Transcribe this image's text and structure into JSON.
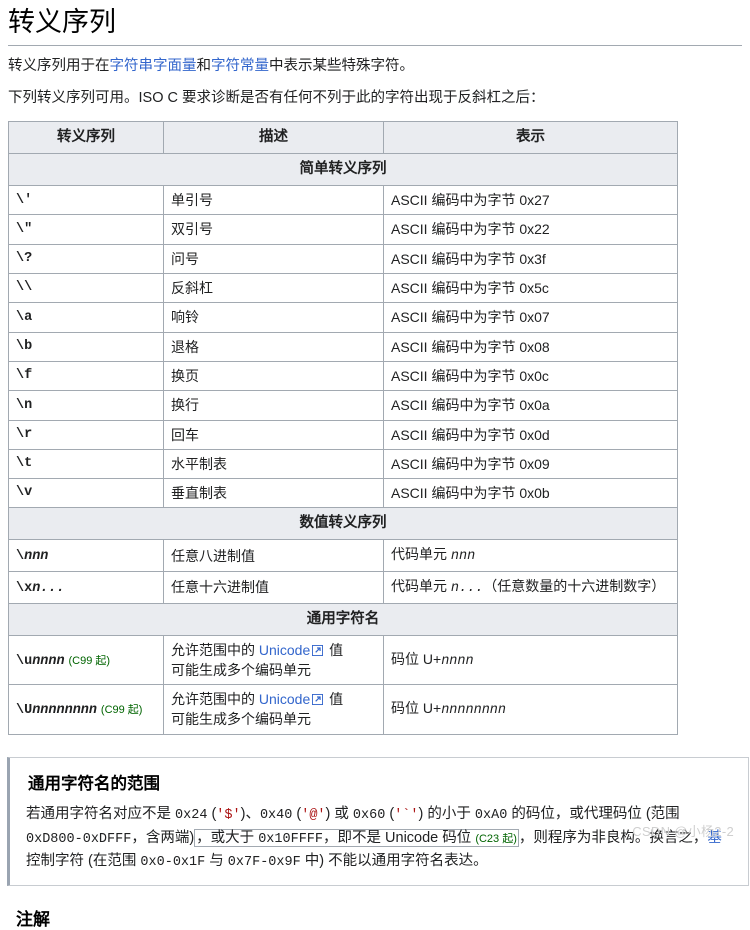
{
  "page": {
    "title": "转义序列",
    "intro_1_prefix": "转义序列用于在",
    "intro_1_link1": "字符串字面量",
    "intro_1_mid": "和",
    "intro_1_link2": "字符常量",
    "intro_1_suffix": "中表示某些特殊字符。",
    "intro_2": "下列转义序列可用。ISO C 要求诊断是否有任何不列于此的字符出现于反斜杠之后："
  },
  "table": {
    "headers": [
      "转义序列",
      "描述",
      "表示"
    ],
    "sections": [
      {
        "title": "简单转义序列",
        "rows": [
          {
            "seq": "\\'",
            "desc": "单引号",
            "repr": "ASCII 编码中为字节 0x27"
          },
          {
            "seq": "\\\"",
            "desc": "双引号",
            "repr": "ASCII 编码中为字节 0x22"
          },
          {
            "seq": "\\?",
            "desc": "问号",
            "repr": "ASCII 编码中为字节 0x3f"
          },
          {
            "seq": "\\\\",
            "desc": "反斜杠",
            "repr": "ASCII 编码中为字节 0x5c"
          },
          {
            "seq": "\\a",
            "desc": "响铃",
            "repr": "ASCII 编码中为字节 0x07"
          },
          {
            "seq": "\\b",
            "desc": "退格",
            "repr": "ASCII 编码中为字节 0x08"
          },
          {
            "seq": "\\f",
            "desc": "换页",
            "repr": "ASCII 编码中为字节 0x0c"
          },
          {
            "seq": "\\n",
            "desc": "换行",
            "repr": "ASCII 编码中为字节 0x0a"
          },
          {
            "seq": "\\r",
            "desc": "回车",
            "repr": "ASCII 编码中为字节 0x0d"
          },
          {
            "seq": "\\t",
            "desc": "水平制表",
            "repr": "ASCII 编码中为字节 0x09"
          },
          {
            "seq": "\\v",
            "desc": "垂直制表",
            "repr": "ASCII 编码中为字节 0x0b"
          }
        ]
      },
      {
        "title": "数值转义序列",
        "rows": [
          {
            "seq_prefix": "\\",
            "seq_italic": "nnn",
            "desc": "任意八进制值",
            "repr_prefix": "代码单元 ",
            "repr_italic": "nnn",
            "repr_suffix": ""
          },
          {
            "seq_prefix": "\\x",
            "seq_italic": "n...",
            "desc": "任意十六进制值",
            "repr_prefix": "代码单元 ",
            "repr_italic": "n...",
            "repr_suffix": "（任意数量的十六进制数字）"
          }
        ]
      },
      {
        "title": "通用字符名",
        "rows": [
          {
            "seq_prefix": "\\u",
            "seq_italic": "nnnn",
            "seq_since": "(C99 起)",
            "desc_line1_prefix": "允许范围中的 ",
            "desc_link": "Unicode",
            "desc_line1_suffix": " 值",
            "desc_line2": "可能生成多个编码单元",
            "repr_prefix": "码位 U+",
            "repr_italic": "nnnn"
          },
          {
            "seq_prefix": "\\U",
            "seq_italic": "nnnnnnnn",
            "seq_since": "(C99 起)",
            "desc_line1_prefix": "允许范围中的 ",
            "desc_link": "Unicode",
            "desc_line1_suffix": " 值",
            "desc_line2": "可能生成多个编码单元",
            "repr_prefix": "码位 U+",
            "repr_italic": "nnnnnnnn"
          }
        ]
      }
    ]
  },
  "notebox": {
    "heading": "通用字符名的范围",
    "t1": "若通用字符名对应不是 ",
    "c1": "0x24",
    "t2": " (",
    "q1": "'$'",
    "t3": ")、",
    "c2": "0x40",
    "t4": " (",
    "q2": "'@'",
    "t5": ") 或 ",
    "c3": "0x60",
    "t6": " (",
    "q3": "'`'",
    "t7": ") 的小于 ",
    "c4": "0xA0",
    "t8": " 的码位，或代理码位 (范围 ",
    "c5": "0xD800",
    "t9": "-",
    "c6": "0xDFFF",
    "t10": "，含两端)",
    "t11": "，或大于 ",
    "c7": "0x10FFFF",
    "t12": "，即不是 Unicode 码位",
    "since": "(C23 起)",
    "t13": "，则程序为非良构。换言之，",
    "link_truncated": "基",
    "t14": "控制字符 (在范围 ",
    "c8": "0x0",
    "t15": "-",
    "c9": "0x1F",
    "t16": " 与 ",
    "c10": "0x7F",
    "t17": "-",
    "c11": "0x9F",
    "t18": " 中) 不能以通用字符名表达。"
  },
  "notes_heading": "注解",
  "watermark": "CSDN @小杨2-2"
}
